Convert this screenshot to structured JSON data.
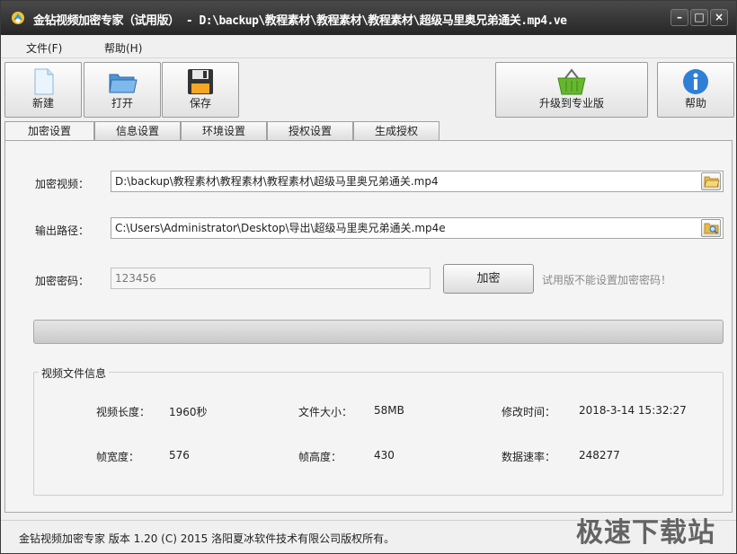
{
  "window": {
    "title": "金钻视频加密专家（试用版） - D:\\backup\\教程素材\\教程素材\\教程素材\\超级马里奥兄弟通关.mp4.ve",
    "min_glyph": "–",
    "max_glyph": "□",
    "close_glyph": "×"
  },
  "menu": {
    "file": "文件(F)",
    "help": "帮助(H)"
  },
  "toolbar": {
    "new_label": "新建",
    "open_label": "打开",
    "save_label": "保存",
    "upgrade_label": "升级到专业版",
    "help_label": "帮助"
  },
  "tabs": [
    {
      "label": "加密设置",
      "active": true
    },
    {
      "label": "信息设置",
      "active": false
    },
    {
      "label": "环境设置",
      "active": false
    },
    {
      "label": "授权设置",
      "active": false
    },
    {
      "label": "生成授权",
      "active": false
    }
  ],
  "form": {
    "video_label": "加密视频：",
    "video_path": "D:\\backup\\教程素材\\教程素材\\教程素材\\超级马里奥兄弟通关.mp4",
    "output_label": "输出路径：",
    "output_path": "C:\\Users\\Administrator\\Desktop\\导出\\超级马里奥兄弟通关.mp4e",
    "password_label": "加密密码：",
    "password_value": "123456",
    "encrypt_button": "加密",
    "trial_hint": "试用版不能设置加密密码！"
  },
  "progress": {
    "fraction": 0
  },
  "video_info": {
    "title": "视频文件信息",
    "duration_label": "视频长度：",
    "duration_value": "1960秒",
    "size_label": "文件大小：",
    "size_value": "58MB",
    "modified_label": "修改时间：",
    "modified_value": "2018-3-14 15:32:27",
    "width_label": "帧宽度：",
    "width_value": "576",
    "height_label": "帧高度：",
    "height_value": "430",
    "bitrate_label": "数据速率：",
    "bitrate_value": "248277"
  },
  "status": {
    "text": "金钻视频加密专家  版本 1.20 (C)  2015 洛阳夏冰软件技术有限公司版权所有。"
  },
  "watermark": "极速下载站",
  "colors": {
    "titlebar": "#2e2e2e",
    "progress_fill": "#4ea82a",
    "help_icon": "#2f7fd6",
    "basket": "#66b72f"
  }
}
